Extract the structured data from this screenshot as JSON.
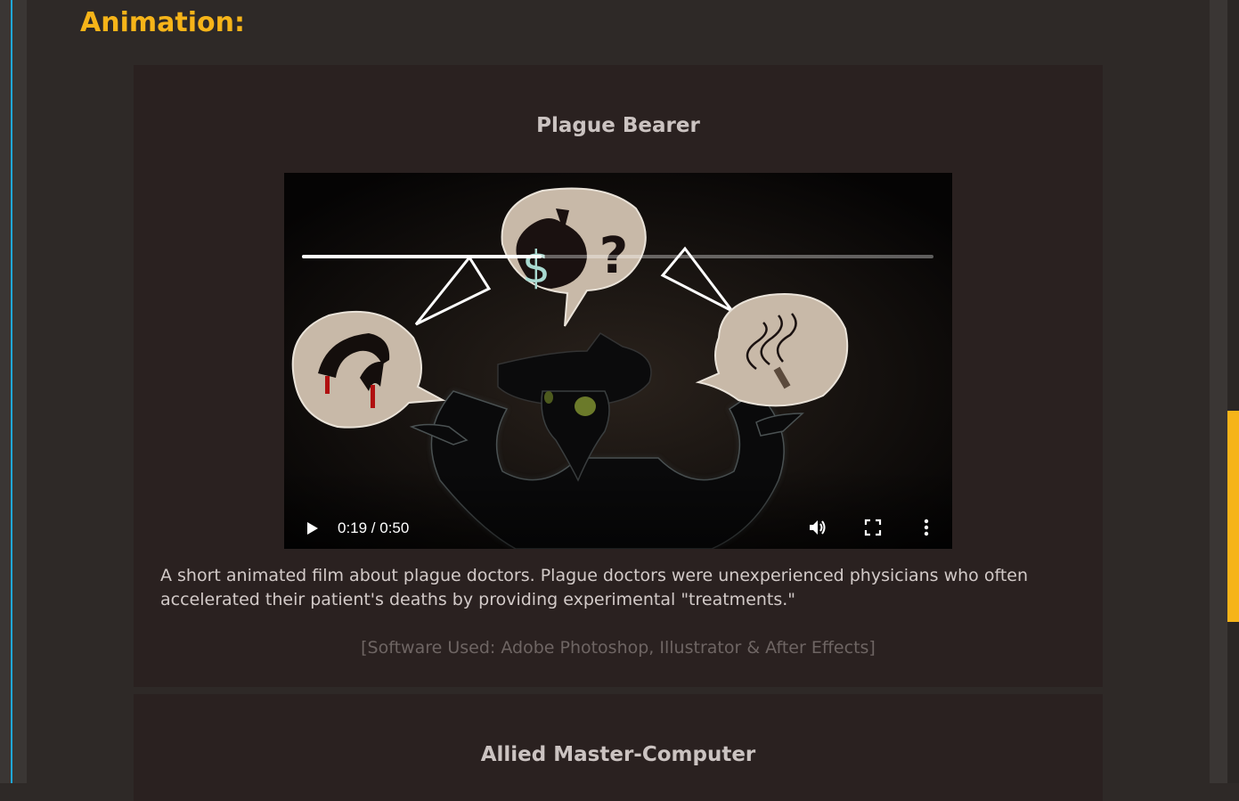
{
  "section": {
    "title": "Animation:"
  },
  "projects": [
    {
      "title": "Plague Bearer",
      "video": {
        "time_label": "0:19 / 0:50",
        "progress": 0.38
      },
      "description": "A short animated film about plague doctors. Plague doctors were unexperienced physicians who often accelerated their patient's deaths by providing experimental \"treatments.\"",
      "software": "[Software Used: Adobe Photoshop, Illustrator & After Effects]"
    },
    {
      "title": "Allied Master-Computer"
    }
  ],
  "icons": {
    "play": "play-icon",
    "volume": "volume-icon",
    "fullscreen": "fullscreen-icon",
    "more": "more-vertical-icon"
  },
  "colors": {
    "accent": "#f6b419",
    "left_accent": "#1fa7d8",
    "page_background": "#2e2927",
    "card_background": "#2a2120"
  }
}
